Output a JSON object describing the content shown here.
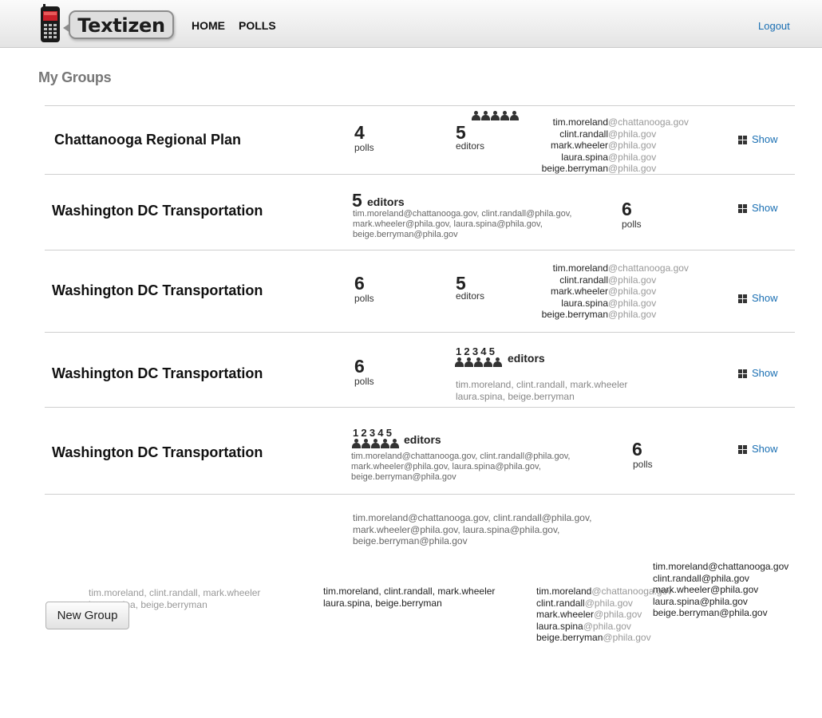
{
  "header": {
    "logo_text": "Textizen",
    "nav": [
      "HOME",
      "POLLS"
    ],
    "logout": "Logout"
  },
  "page_title": "My Groups",
  "show_label": "Show",
  "editors_word": "editors",
  "polls_word": "polls",
  "groups": [
    {
      "name": "Chattanooga Regional Plan",
      "polls": "4",
      "editors": "5"
    },
    {
      "name": "Washington DC Transportation",
      "polls": "6",
      "editors": "5"
    },
    {
      "name": "Washington DC Transportation",
      "polls": "6",
      "editors": "5"
    },
    {
      "name": "Washington DC Transportation",
      "polls": "6",
      "editors": "5"
    },
    {
      "name": "Washington DC Transportation",
      "polls": "6",
      "editors": "5"
    }
  ],
  "editor_numbers": "12345",
  "editor_users": [
    "tim.moreland",
    "clint.randall",
    "mark.wheeler",
    "laura.spina",
    "beige.berryman"
  ],
  "editor_domains": [
    "@chattanooga.gov",
    "@phila.gov",
    "@phila.gov",
    "@phila.gov",
    "@phila.gov"
  ],
  "emails_inline": [
    "tim.moreland@chattanooga.gov, clint.randall@phila.gov,",
    "mark.wheeler@phila.gov, laura.spina@phila.gov,",
    "beige.berryman@phila.gov"
  ],
  "names_inline": [
    "tim.moreland, clint.randall, mark.wheeler",
    "laura.spina, beige.berryman"
  ],
  "emails_plain": [
    "tim.moreland@chattanooga.gov",
    "clint.randall@phila.gov",
    "mark.wheeler@phila.gov",
    "laura.spina@phila.gov",
    "beige.berryman@phila.gov"
  ],
  "new_group_label": "New Group"
}
